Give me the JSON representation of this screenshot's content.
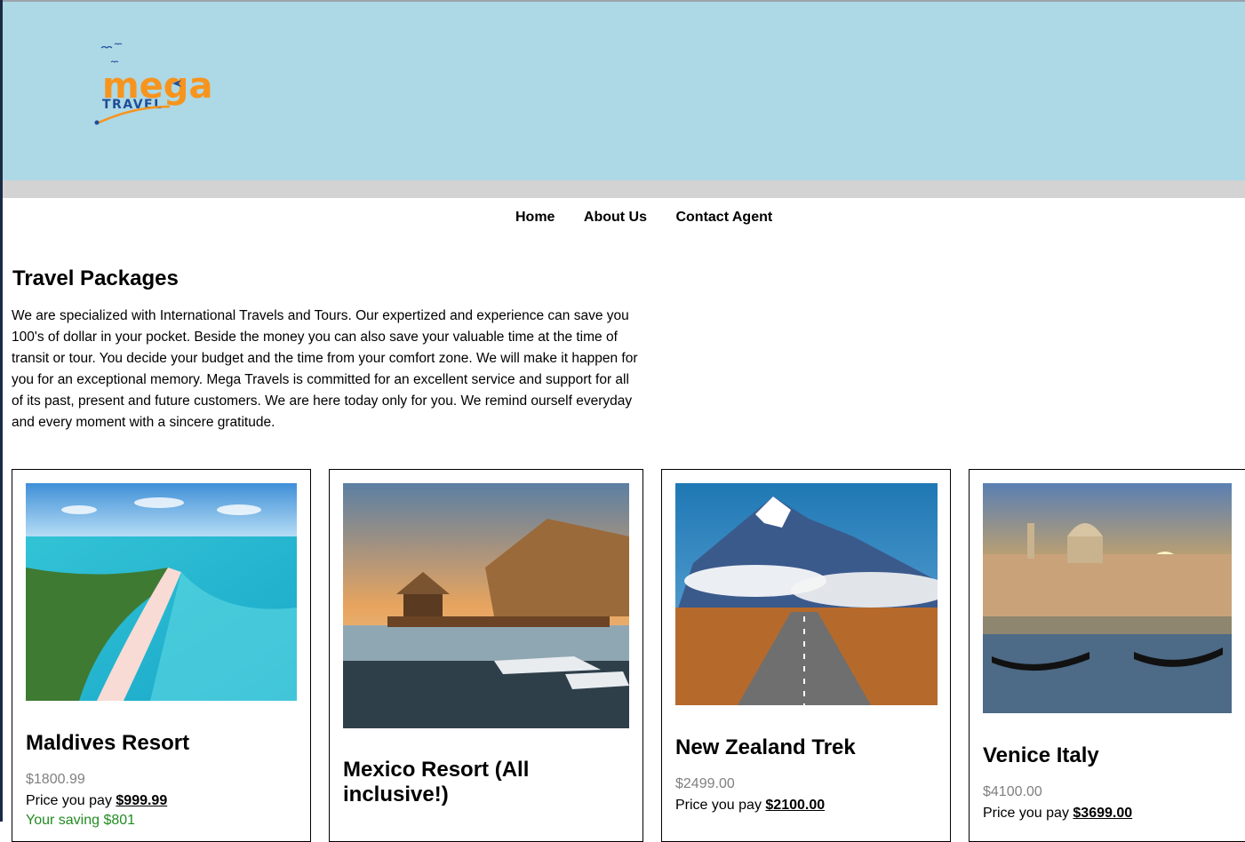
{
  "logo": {
    "word": "mega",
    "sub": "TRAVEL"
  },
  "nav": {
    "items": [
      "Home",
      "About Us",
      "Contact Agent"
    ]
  },
  "main": {
    "title": "Travel Packages",
    "intro": "We are specialized with International Travels and Tours. Our expertized and experience can save you 100's of dollar in your pocket. Beside the money you can also save your valuable time at the time of transit or tour. You decide your budget and the time from your comfort zone. We will make it happen for you for an exceptional memory. Mega Travels is committed for an excellent service and support for all of its past, present and future customers. We are here today only for you. We remind ourself everyday and every moment with a sincere gratitude."
  },
  "packages": [
    {
      "name": "Maldives Resort",
      "old_price": "$1800.99",
      "pay_label": "Price you pay",
      "price": "$999.99",
      "saving": "Your saving $801"
    },
    {
      "name": "Mexico Resort (All inclusive!)",
      "old_price": "",
      "pay_label": "",
      "price": "",
      "saving": ""
    },
    {
      "name": "New Zealand Trek",
      "old_price": "$2499.00",
      "pay_label": "Price you pay",
      "price": "$2100.00",
      "saving": ""
    },
    {
      "name": "Venice Italy",
      "old_price": "$4100.00",
      "pay_label": "Price you pay",
      "price": "$3699.00",
      "saving": ""
    }
  ],
  "colors": {
    "header_bg": "#add8e6",
    "strip": "#d3d3d3",
    "logo_orange": "#f7941d",
    "logo_blue": "#1f4e99",
    "saving_green": "#228b22",
    "old_price_grey": "#808080"
  }
}
